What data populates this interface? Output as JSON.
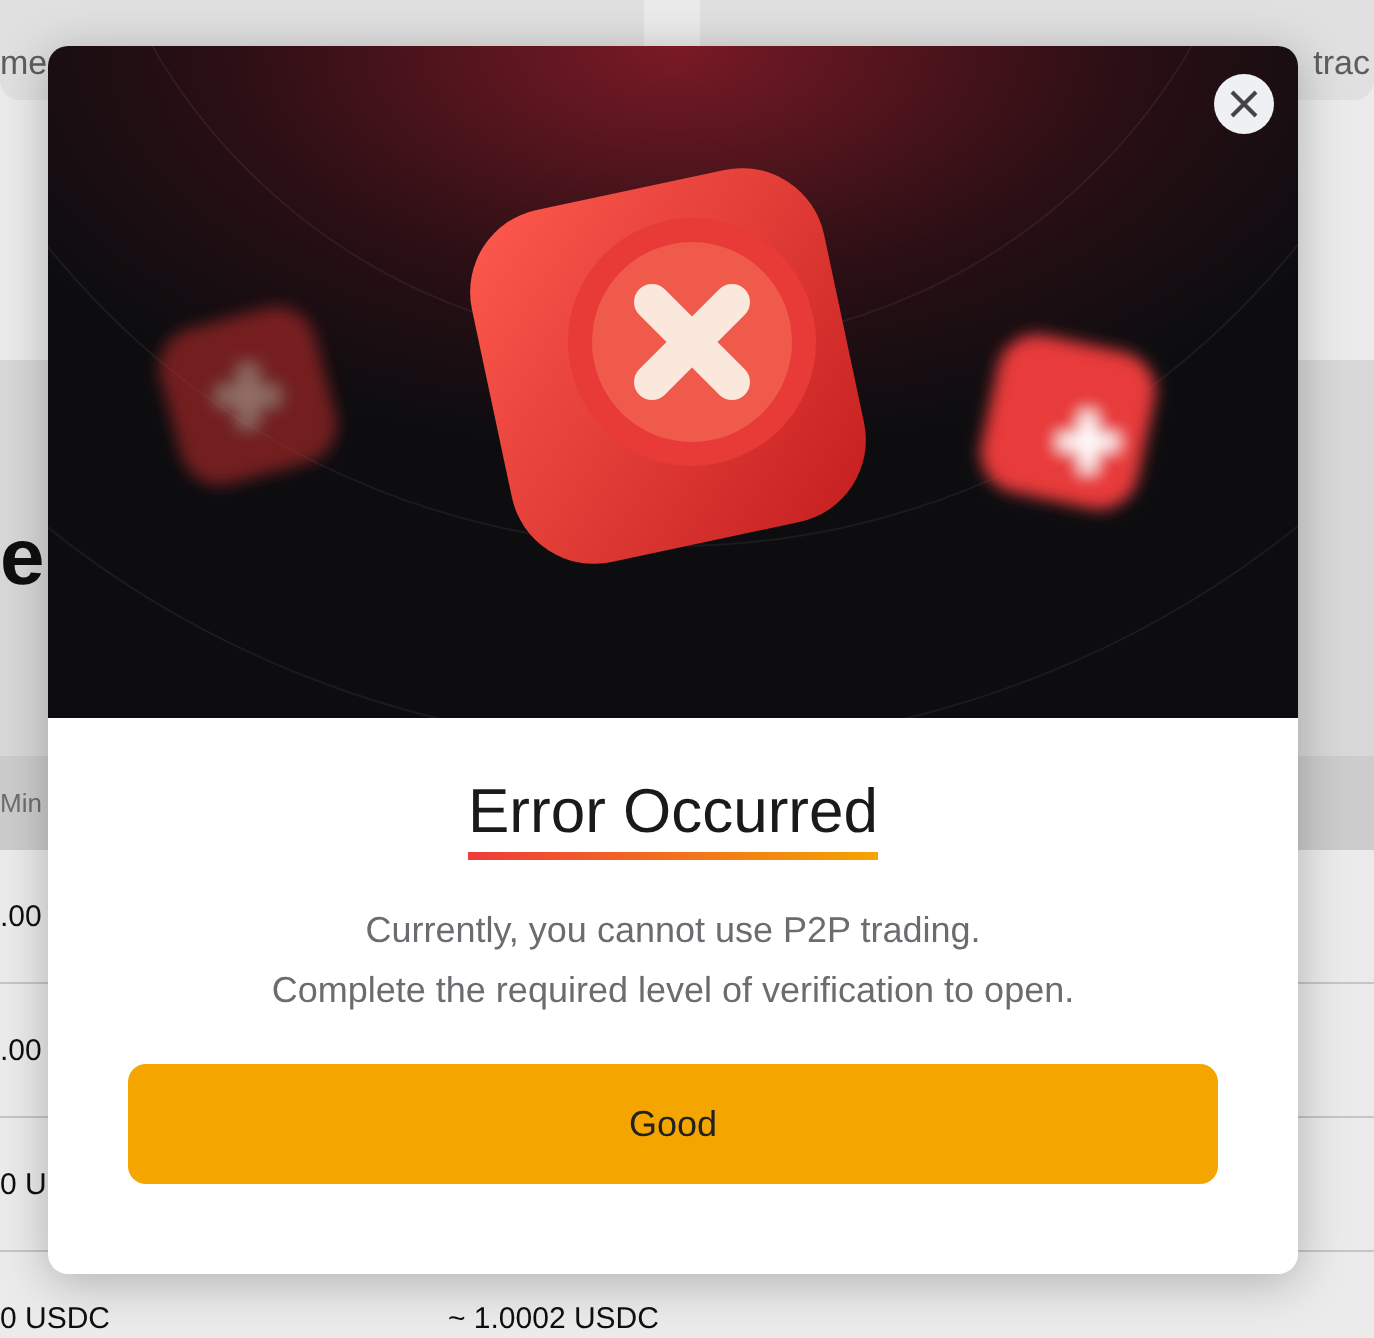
{
  "background_page": {
    "top_cards": [
      "me",
      "trac"
    ],
    "heading": "e",
    "table": {
      "columns": [
        "Min"
      ],
      "rows": [
        {
          "cells": [
            ".00"
          ]
        },
        {
          "cells": [
            ".00"
          ]
        },
        {
          "cells": [
            "0 U"
          ]
        },
        {
          "cells": [
            "0 USDC",
            "~ 1.0002 USDC"
          ]
        }
      ]
    }
  },
  "dialog": {
    "title": "Error Occurred",
    "message": [
      "Currently, you cannot use P2P trading.",
      "Complete the required level of verification to open."
    ],
    "button": "Good"
  }
}
